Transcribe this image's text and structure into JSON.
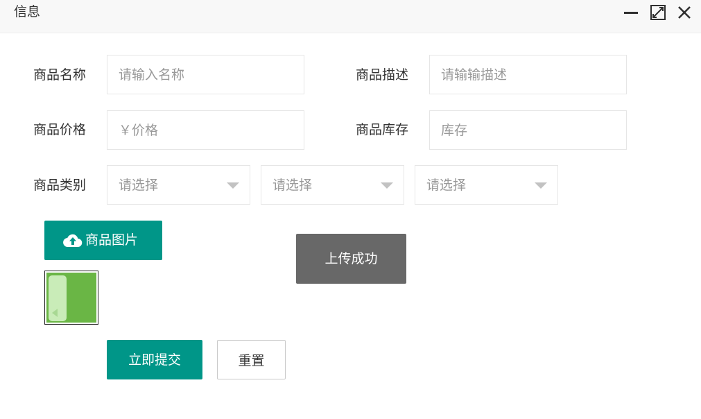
{
  "window": {
    "title": "信息",
    "controls": [
      "minimize-icon",
      "maximize-icon",
      "close-icon"
    ]
  },
  "form": {
    "name": {
      "label": "商品名称",
      "placeholder": "请输入名称",
      "value": ""
    },
    "description": {
      "label": "商品描述",
      "placeholder": "请输输描述",
      "value": ""
    },
    "price": {
      "label": "商品价格",
      "placeholder": "￥价格",
      "value": ""
    },
    "stock": {
      "label": "商品库存",
      "placeholder": "库存",
      "value": ""
    },
    "category": {
      "label": "商品类别",
      "selects": [
        {
          "placeholder": "请选择"
        },
        {
          "placeholder": "请选择"
        },
        {
          "placeholder": "请选择"
        }
      ]
    },
    "upload": {
      "label": "商品图片",
      "icon": "cloud-upload-icon"
    },
    "submit_label": "立即提交",
    "reset_label": "重置"
  },
  "toast": {
    "message": "上传成功"
  },
  "colors": {
    "primary": "#009688",
    "toast_bg": "#686868",
    "border": "#e6e6e6",
    "placeholder": "#999999",
    "thumbnail_green": "#6ab645"
  }
}
